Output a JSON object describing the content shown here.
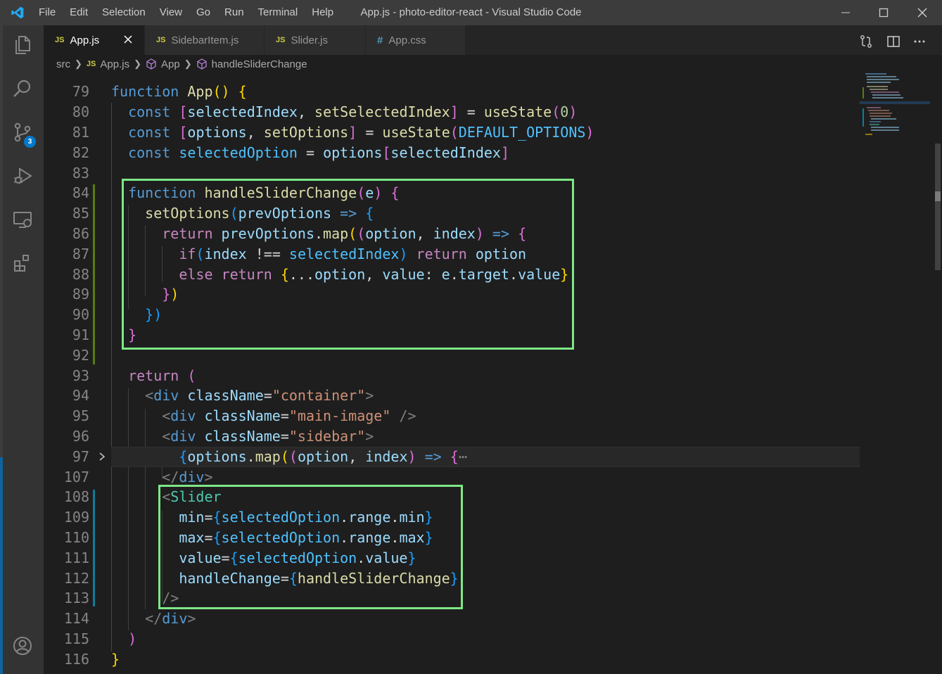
{
  "window": {
    "title": "App.js - photo-editor-react - Visual Studio Code"
  },
  "menu": [
    "File",
    "Edit",
    "Selection",
    "View",
    "Go",
    "Run",
    "Terminal",
    "Help"
  ],
  "activity": {
    "scm_badge": "3"
  },
  "tabs": [
    {
      "label": "App.js",
      "icon": "JS",
      "active": true
    },
    {
      "label": "SidebarItem.js",
      "icon": "JS",
      "active": false
    },
    {
      "label": "Slider.js",
      "icon": "JS",
      "active": false
    },
    {
      "label": "App.css",
      "icon": "#",
      "active": false
    }
  ],
  "breadcrumb": {
    "folder": "src",
    "file": "App.js",
    "file_icon": "JS",
    "symbol1": "App",
    "symbol2": "handleSliderChange"
  },
  "editor": {
    "line_numbers": [
      "79",
      "80",
      "81",
      "82",
      "83",
      "84",
      "85",
      "86",
      "87",
      "88",
      "89",
      "90",
      "91",
      "92",
      "93",
      "94",
      "95",
      "96",
      "97",
      "107",
      "108",
      "109",
      "110",
      "111",
      "112",
      "113",
      "114",
      "115",
      "116"
    ],
    "lines": [
      "function App() {",
      "  const [selectedIndex, setSelectedIndex] = useState(0)",
      "  const [options, setOptions] = useState(DEFAULT_OPTIONS)",
      "  const selectedOption = options[selectedIndex]",
      "",
      "  function handleSliderChange(e) {",
      "    setOptions(prevOptions => {",
      "      return prevOptions.map((option, index) => {",
      "        if(index !== selectedIndex) return option",
      "        else return {...option, value: e.target.value}",
      "      })",
      "    })",
      "  }",
      "",
      "  return (",
      "    <div className=\"container\">",
      "      <div className=\"main-image\" />",
      "      <div className=\"sidebar\">",
      "        {options.map((option, index) => {⋯",
      "      </div>",
      "      <Slider",
      "        min={selectedOption.range.min}",
      "        max={selectedOption.range.max}",
      "        value={selectedOption.value}",
      "        handleChange={handleSliderChange}",
      "      />",
      "    </div>",
      "  )",
      "}"
    ]
  },
  "colors": {
    "highlight_box": "#7ee787",
    "accent": "#007acc"
  }
}
